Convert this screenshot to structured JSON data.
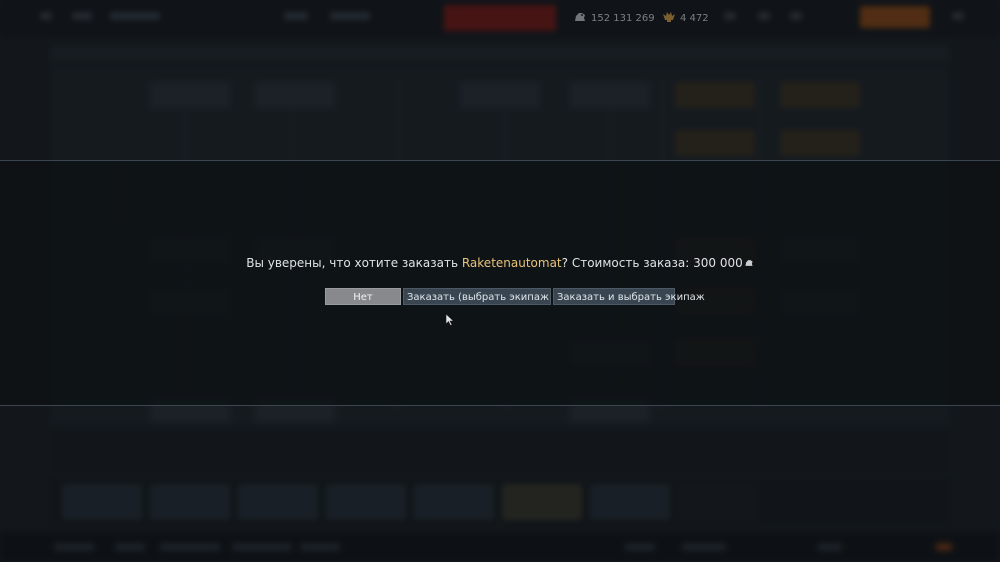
{
  "currency": {
    "silver_amount": "152 131 269",
    "silver_icon": "silver-lion-icon",
    "gold_amount": "4 472",
    "gold_icon": "golden-eagle-icon"
  },
  "dialog": {
    "prefix": "Вы уверены, что хотите заказать ",
    "vehicle_name": "Raketenautomat",
    "suffix": "? Стоимость заказа: 300 000",
    "cost_icon": "silver-lion-icon",
    "buttons": {
      "no": "Нет",
      "order_later": "Заказать (выбрать экипаж позже)",
      "order_and_choose": "Заказать и выбрать экипаж"
    }
  },
  "colors": {
    "vehicle_highlight": "#e8c27a",
    "no_button": "#87898c",
    "action_button": "#394652"
  }
}
